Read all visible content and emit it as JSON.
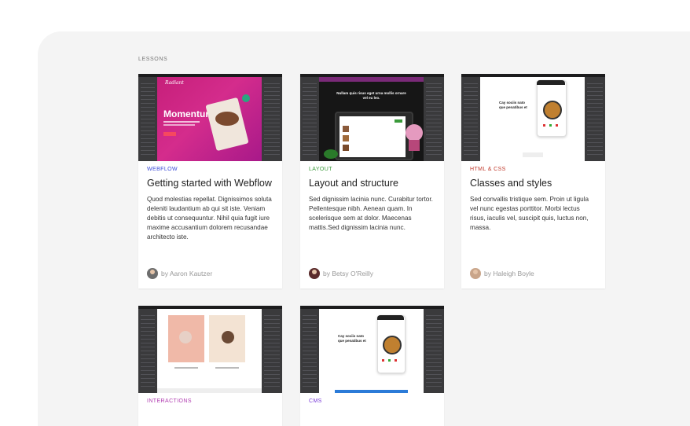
{
  "section_label": "LESSONS",
  "cards": [
    {
      "tag": "WEBFLOW",
      "tag_color": "#3b4bd8",
      "title": "Getting started with Webflow",
      "description": "Quod molestias repellat. Dignissimos soluta deleniti laudantium ab qui sit iste. Veniam debitis ut consequuntur. Nihil quia fugit iure maxime accusantium dolorem recusandae architecto iste.",
      "author": "by Aaron Kautzer",
      "thumb_heading": "Momentum",
      "thumb_logo": "Radiant"
    },
    {
      "tag": "LAYOUT",
      "tag_color": "#3a9a3a",
      "title": "Layout and structure",
      "description": "Sed dignissim lacinia nunc. Curabitur tortor. Pellentesque nibh. Aenean quam. In scelerisque sem at dolor. Maecenas mattis.Sed dignissim lacinia nunc.",
      "author": "by Betsy O'Reilly",
      "thumb_heading": "Nullam quis risus eget urna mollis ornare vel eu leo."
    },
    {
      "tag": "HTML & CSS",
      "tag_color": "#c0392b",
      "title": "Classes and styles",
      "description": "Sed convallis tristique sem. Proin ut ligula vel nunc egestas porttitor. Morbi lectus risus, iaculis vel, suscipit quis, luctus non, massa.",
      "author": "by Haleigh Boyle",
      "thumb_heading": "Cay sociis nato que penatibus et"
    },
    {
      "tag": "INTERACTIONS",
      "tag_color": "#b03bb0"
    },
    {
      "tag": "CMS",
      "tag_color": "#7a3bd8",
      "thumb_heading": "Cay sociis nato que penatibus et"
    }
  ]
}
